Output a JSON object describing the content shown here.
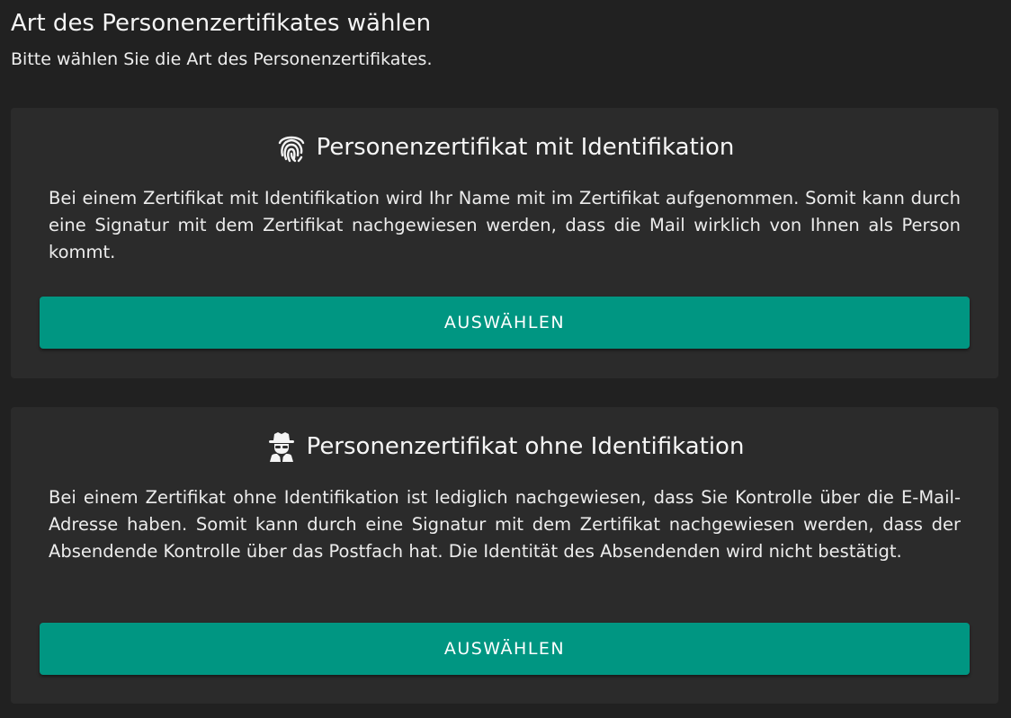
{
  "page": {
    "title": "Art des Personenzertifikates wählen",
    "subtitle": "Bitte wählen Sie die Art des Personenzertifikates."
  },
  "options": [
    {
      "icon": "fingerprint-icon",
      "title": "Personenzertifikat mit Identifikation",
      "description": "Bei einem Zertifikat mit Identifikation wird Ihr Name mit im Zertifikat aufgenommen. Somit kann durch eine Signatur mit dem Zertifikat nachgewiesen werden, dass die Mail wirklich von Ihnen als Person kommt.",
      "button_label": "AUSWÄHLEN"
    },
    {
      "icon": "user-secret-icon",
      "title": "Personenzertifikat ohne Identifikation",
      "description": "Bei einem Zertifikat ohne Identifikation ist lediglich nachgewiesen, dass Sie Kontrolle über die E-Mail-Adresse haben. Somit kann durch eine Signatur mit dem Zertifikat nachgewiesen werden, dass der Absendende Kontrolle über das Postfach hat. Die Identität des Absendenden wird nicht bestätigt.",
      "button_label": "AUSWÄHLEN"
    }
  ],
  "colors": {
    "background": "#212121",
    "card": "#2b2b2b",
    "accent": "#009682",
    "text": "#f2f2f2"
  }
}
